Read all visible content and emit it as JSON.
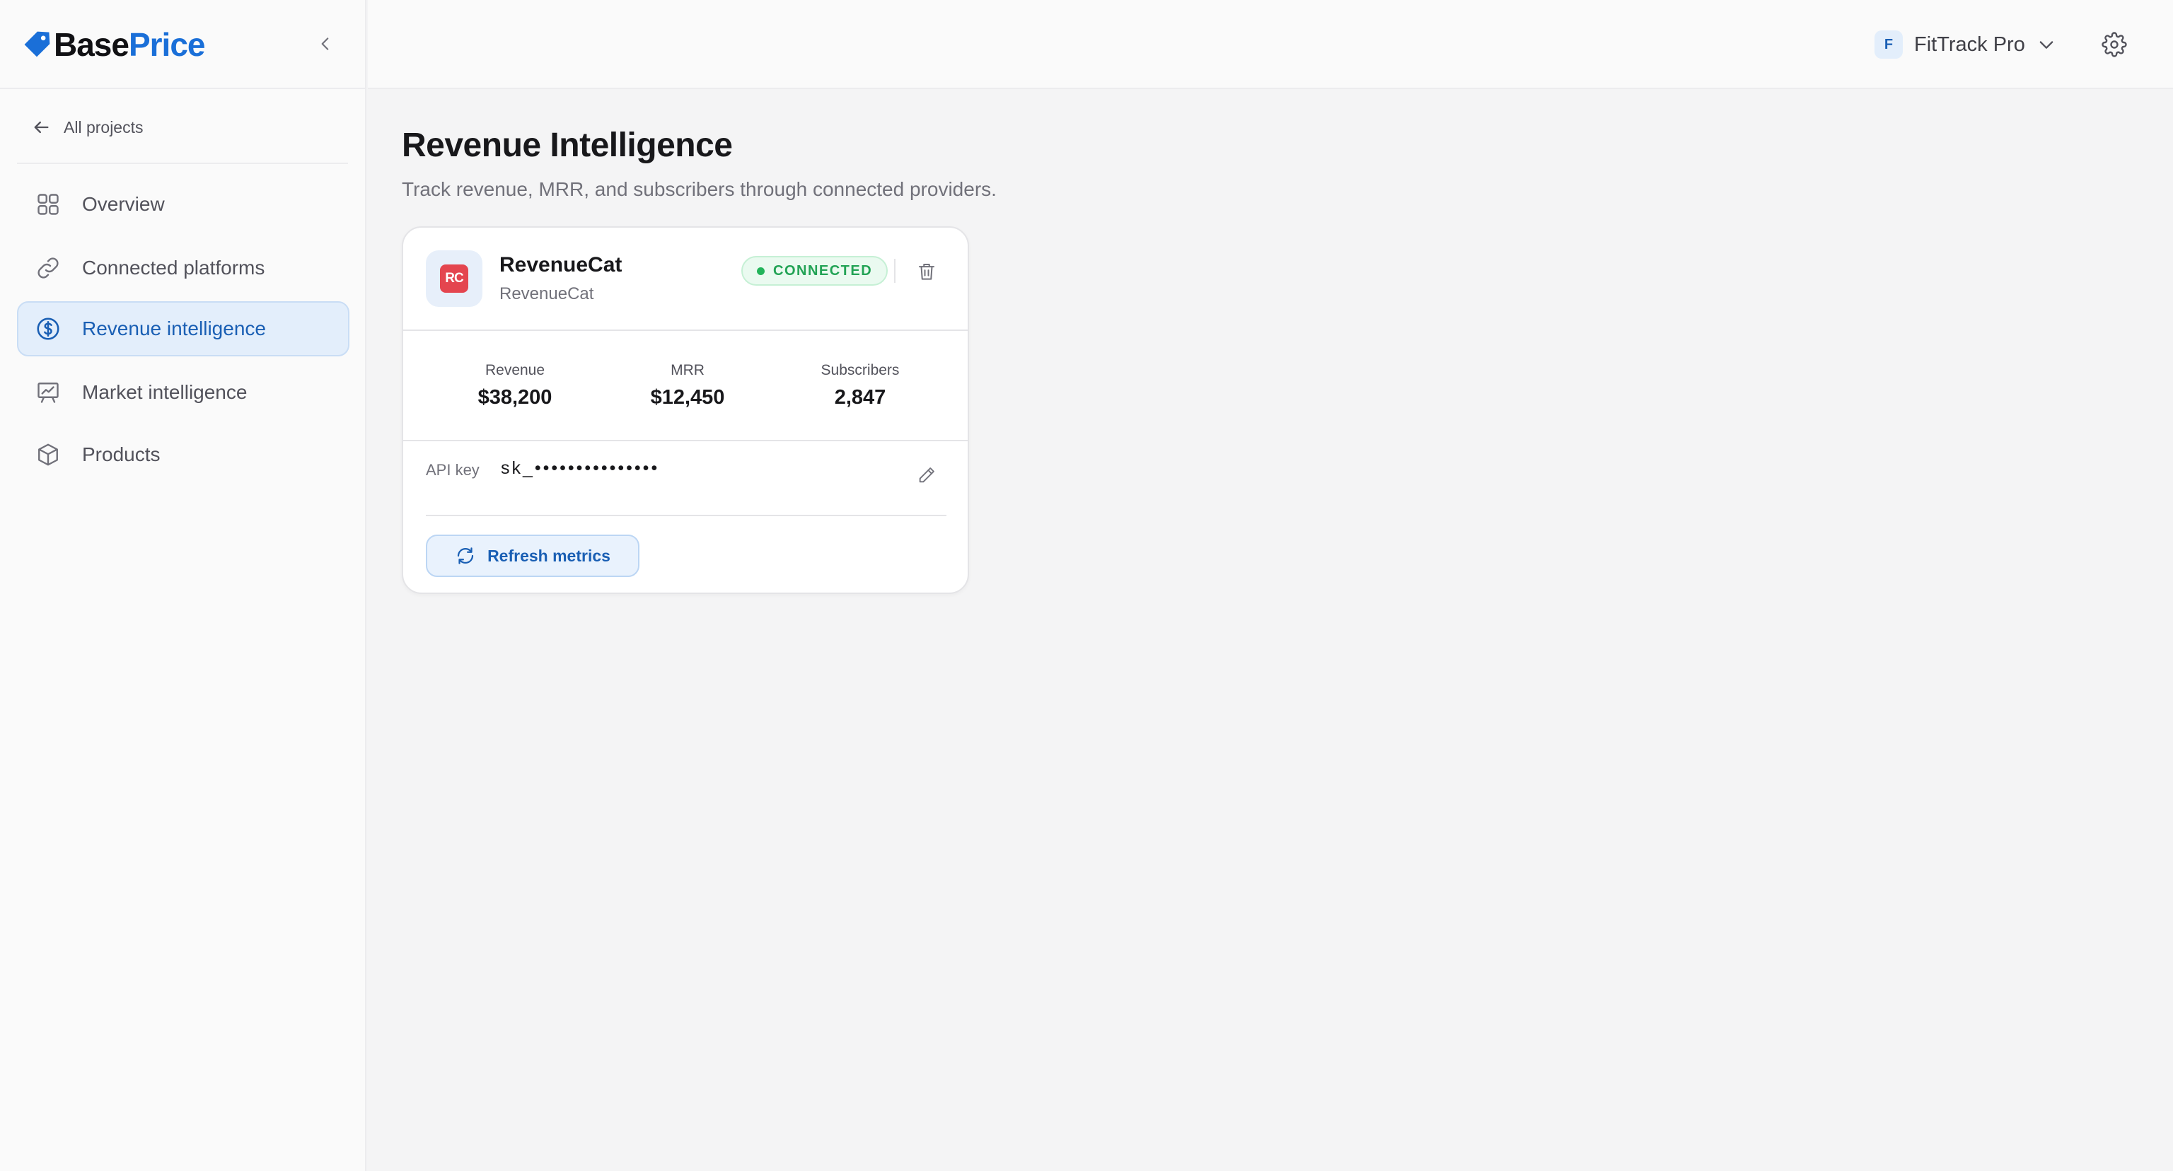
{
  "brand": {
    "name_part1": "Base",
    "name_part2": "Price"
  },
  "sidebar": {
    "back_label": "All projects",
    "items": [
      {
        "label": "Overview",
        "icon": "grid-icon",
        "active": false
      },
      {
        "label": "Connected platforms",
        "icon": "link-icon",
        "active": false
      },
      {
        "label": "Revenue intelligence",
        "icon": "dollar-circle-icon",
        "active": true
      },
      {
        "label": "Market intelligence",
        "icon": "chart-presentation-icon",
        "active": false
      },
      {
        "label": "Products",
        "icon": "box-icon",
        "active": false
      }
    ]
  },
  "topbar": {
    "project_initial": "F",
    "project_name": "FitTrack Pro"
  },
  "page": {
    "title": "Revenue Intelligence",
    "subtitle": "Track revenue, MRR, and subscribers through connected providers."
  },
  "provider_card": {
    "logo_text": "RC",
    "name": "RevenueCat",
    "subname": "RevenueCat",
    "status": "CONNECTED",
    "metrics": [
      {
        "label": "Revenue",
        "value": "$38,200"
      },
      {
        "label": "MRR",
        "value": "$12,450"
      },
      {
        "label": "Subscribers",
        "value": "2,847"
      }
    ],
    "api_key_label": "API key",
    "api_key_value": "sk_•••••••••••••••",
    "refresh_label": "Refresh metrics"
  },
  "colors": {
    "accent": "#1a6fd8",
    "active_bg": "#e3eefb",
    "status_green": "#22a355",
    "provider_red": "#e4454f"
  }
}
